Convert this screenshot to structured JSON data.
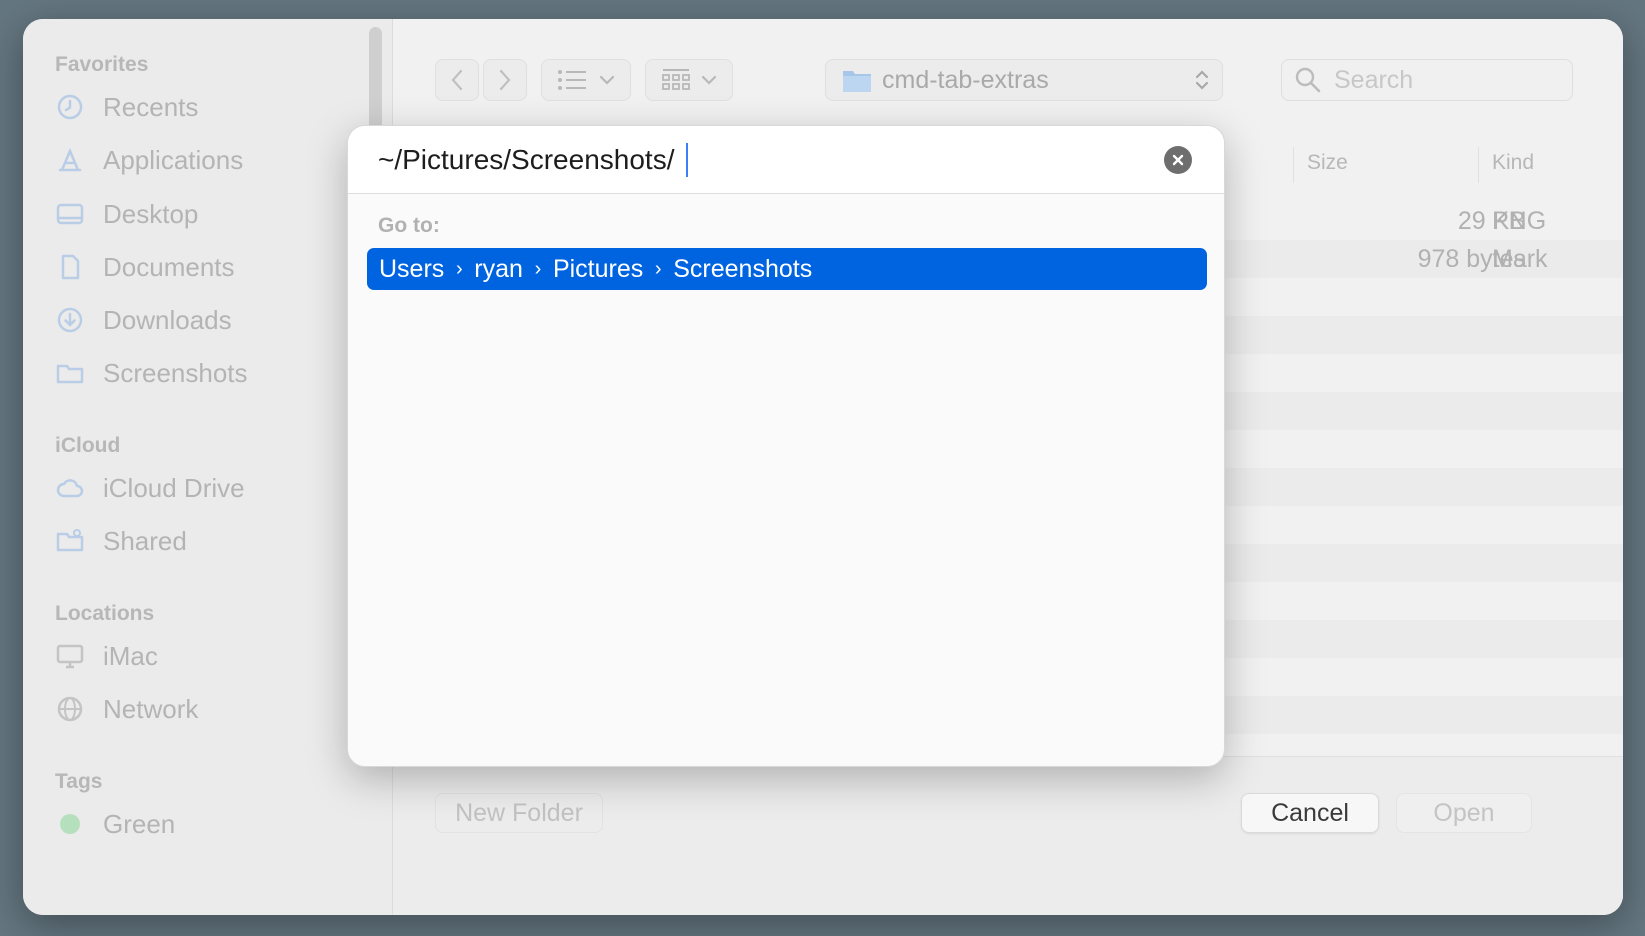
{
  "sidebar": {
    "favorites_title": "Favorites",
    "favorites": [
      {
        "label": "Recents",
        "icon": "clock-icon"
      },
      {
        "label": "Applications",
        "icon": "applications-icon"
      },
      {
        "label": "Desktop",
        "icon": "desktop-icon"
      },
      {
        "label": "Documents",
        "icon": "document-icon"
      },
      {
        "label": "Downloads",
        "icon": "download-icon"
      },
      {
        "label": "Screenshots",
        "icon": "folder-icon"
      }
    ],
    "icloud_title": "iCloud",
    "icloud": [
      {
        "label": "iCloud Drive",
        "icon": "cloud-icon"
      },
      {
        "label": "Shared",
        "icon": "shared-folder-icon"
      }
    ],
    "locations_title": "Locations",
    "locations": [
      {
        "label": "iMac",
        "icon": "imac-icon"
      },
      {
        "label": "Network",
        "icon": "network-globe-icon"
      }
    ],
    "tags_title": "Tags",
    "tags": [
      {
        "label": "Green",
        "color": "#b6dfbe"
      }
    ]
  },
  "toolbar": {
    "current_folder": "cmd-tab-extras",
    "search_placeholder": "Search"
  },
  "file_list": {
    "columns": {
      "size": "Size",
      "kind": "Kind"
    },
    "rows": [
      {
        "size": "29 KB",
        "kind": "PNG"
      },
      {
        "size": "978 bytes",
        "kind": "Mark"
      }
    ]
  },
  "bottom_bar": {
    "new_folder": "New Folder",
    "cancel": "Cancel",
    "open": "Open"
  },
  "goto_sheet": {
    "input_value": "~/Pictures/Screenshots/",
    "goto_label": "Go to:",
    "suggestion_path": [
      "Users",
      "ryan",
      "Pictures",
      "Screenshots"
    ],
    "separator": "›"
  },
  "colors": {
    "accent": "#0064e1",
    "backdrop": "#647680"
  }
}
